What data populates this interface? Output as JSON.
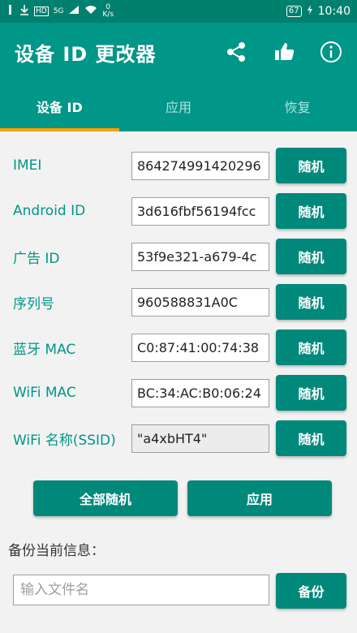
{
  "status_bar": {
    "network_badge": "HD",
    "signal_label": "5G",
    "net_speed_value": "0",
    "net_speed_unit": "K/s",
    "battery": "67",
    "time": "10:40"
  },
  "app_bar": {
    "title": "设备 ID 更改器",
    "icons": [
      "share-icon",
      "thumbs-up-icon",
      "info-icon"
    ]
  },
  "tabs": [
    {
      "label": "设备 ID",
      "active": true
    },
    {
      "label": "应用",
      "active": false
    },
    {
      "label": "恢复",
      "active": false
    }
  ],
  "fields": [
    {
      "label": "IMEI",
      "value": "864274991420296",
      "button": "随机"
    },
    {
      "label": "Android ID",
      "value": "3d616fbf56194fcc",
      "button": "随机"
    },
    {
      "label": "广告 ID",
      "value": "53f9e321-a679-4c",
      "button": "随机"
    },
    {
      "label": "序列号",
      "value": "960588831A0C",
      "button": "随机"
    },
    {
      "label": "蓝牙 MAC",
      "value": "C0:87:41:00:74:38",
      "button": "随机"
    },
    {
      "label": "WiFi MAC",
      "value": "BC:34:AC:B0:06:24",
      "button": "随机"
    },
    {
      "label": "WiFi 名称(SSID)",
      "value": "\"a4xbHT4\"",
      "button": "随机"
    }
  ],
  "actions": {
    "randomize_all": "全部随机",
    "apply": "应用"
  },
  "backup": {
    "label": "备份当前信息：",
    "placeholder": "输入文件名",
    "button": "备份"
  },
  "colors": {
    "primary": "#009688",
    "primary_dark": "#00806e",
    "button": "#00897b",
    "tab_indicator": "#ffa000"
  }
}
